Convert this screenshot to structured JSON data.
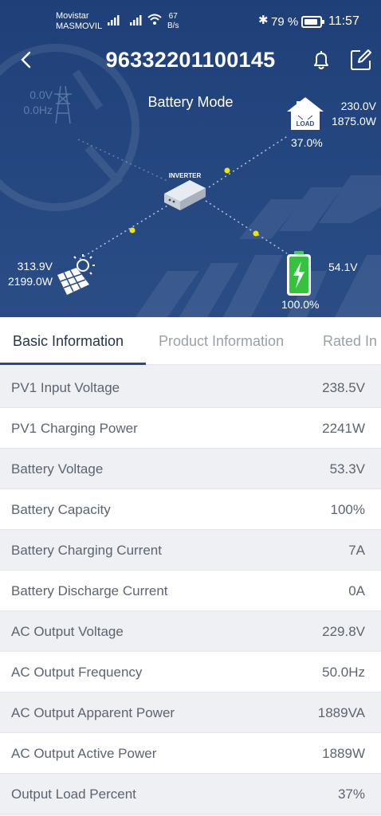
{
  "status_bar": {
    "carrier_line1": "Movistar",
    "carrier_line2": "MASMOVIL",
    "speed_value": "67",
    "speed_unit": "B/s",
    "battery": "79 %",
    "time": "11:57"
  },
  "header": {
    "title": "96332201100145",
    "back_icon": "chevron-left-icon",
    "bell_icon": "bell-icon",
    "edit_icon": "edit-icon"
  },
  "diagram": {
    "mode": "Battery Mode",
    "grid": {
      "voltage": "0.0V",
      "frequency": "0.0Hz"
    },
    "load": {
      "voltage": "230.0V",
      "power": "1875.0W",
      "percent": "37.0%",
      "icon_label": "LOAD"
    },
    "inverter": {
      "label": "INVERTER"
    },
    "pv": {
      "voltage": "313.9V",
      "power": "2199.0W"
    },
    "battery": {
      "voltage": "54.1V",
      "percent": "100.0%"
    },
    "colors": {
      "flow_dot": "#f2e600",
      "battery_green": "#33c33d",
      "hero_bg": "#24467f"
    }
  },
  "tabs": [
    {
      "label": "Basic Information",
      "active": true
    },
    {
      "label": "Product Information",
      "active": false
    },
    {
      "label": "Rated In",
      "active": false
    }
  ],
  "rows": [
    {
      "label": "PV1 Input Voltage",
      "value": "238.5V"
    },
    {
      "label": "PV1 Charging Power",
      "value": "2241W"
    },
    {
      "label": "Battery Voltage",
      "value": "53.3V"
    },
    {
      "label": "Battery Capacity",
      "value": "100%"
    },
    {
      "label": "Battery Charging Current",
      "value": "7A"
    },
    {
      "label": "Battery Discharge Current",
      "value": "0A"
    },
    {
      "label": "AC Output Voltage",
      "value": "229.8V"
    },
    {
      "label": "AC Output Frequency",
      "value": "50.0Hz"
    },
    {
      "label": "AC Output Apparent Power",
      "value": "1889VA"
    },
    {
      "label": "AC Output Active Power",
      "value": "1889W"
    },
    {
      "label": "Output Load Percent",
      "value": "37%"
    }
  ]
}
